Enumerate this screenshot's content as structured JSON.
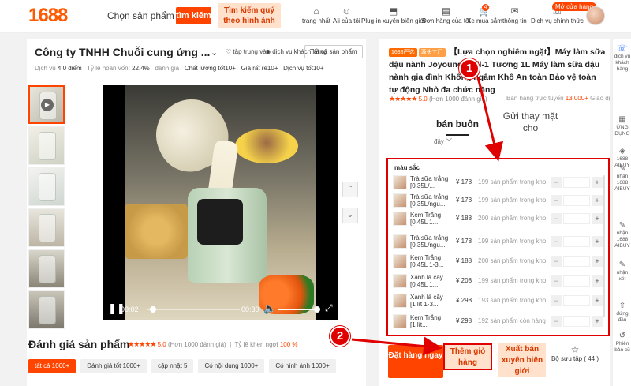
{
  "header": {
    "logo": "1688",
    "search_label": "Chọn sản phẩm tốt",
    "search_button": "tìm kiếm",
    "image_search_line1": "Tìm kiếm quý",
    "image_search_line2": "theo hình ảnh",
    "nav": [
      {
        "label": "trang nhất",
        "icon": "home-icon"
      },
      {
        "label": "Ali của tôi",
        "icon": "user-icon"
      },
      {
        "label": "Plug-in xuyên biên giới",
        "icon": "plugin-icon"
      },
      {
        "label": "Đơn hàng của tôi",
        "icon": "orders-icon"
      },
      {
        "label": "Xe mua sắm",
        "icon": "cart-icon",
        "badge": "4"
      },
      {
        "label": "thông tin",
        "icon": "message-icon"
      },
      {
        "label": "Dịch vụ chính thức",
        "icon": "headset-icon"
      }
    ],
    "store_badge": "Mở cửa hàng"
  },
  "store": {
    "company": "Công ty TNHH Chuỗi cung ứng ...",
    "follow": "tập trung vào",
    "contact": "dịch vụ khách hàng",
    "all_products": "Tất cả sản phẩm",
    "service_label": "Dịch vụ",
    "service_score": "4.0 điểm",
    "return_label": "Tỷ lệ hoàn vốn",
    "return_value": ": 22.4%",
    "eval_label": "đánh giá",
    "quality": "Chất lượng tốt10+",
    "price": "Giá rất rẻ10+",
    "service_good": "Dịch vụ tốt10+"
  },
  "video": {
    "current": "00:02",
    "duration": "00:30",
    "progress": 0.07
  },
  "reviews": {
    "title": "Đánh giá sản phẩm",
    "stars": "★★★★★",
    "score": "5.0",
    "count": "(Hơn 1000 đánh giá)",
    "recommend_label": "Tỷ lệ khen ngợi",
    "recommend_value": "100 %",
    "chips": [
      "tất cả 1000+",
      "Đánh giá tốt 1000+",
      "cập nhật 5",
      "Có nội dung 1000+",
      "Có hình ảnh 1000+"
    ]
  },
  "product": {
    "tag1": "1688严选",
    "tag2": "源头工厂",
    "title": "【Lựa chọn nghiêm ngặt】Máy làm sữa đậu nành Joyoung Wall-1 Tương 1L Máy làm sữa đậu nành gia đình Không ngâm Khô An toàn Bảo vệ toàn tự động Nhỏ đa chức năng",
    "stars": "★★★★★",
    "score": "5.0",
    "count": "(Hơn 1000 đánh giá)",
    "online_label": "Bán hàng trực tuyến",
    "online_value": "13.000+",
    "online_suffix": "Giao dị",
    "tab_wholesale": "bán buôn",
    "tab_dropship": "Gửi thay mặt cho",
    "filter": "đây ﹀",
    "variant_label": "màu sắc",
    "variants": [
      {
        "name1": "Trà sữa trắng",
        "name2": "[0.35L/...",
        "price": "¥ 178",
        "stock": "199 sản phẩm trong kho"
      },
      {
        "name1": "Trà sữa trắng",
        "name2": "[0.35L/ngu...",
        "price": "¥ 178",
        "stock": "199 sản phẩm trong kho"
      },
      {
        "name1": "Kem Trắng",
        "name2": "[0.45L 1...",
        "price": "¥ 188",
        "stock": "200 sản phẩm trong kho"
      },
      {
        "name1": "Trà sữa trắng",
        "name2": "[0.35L/ngu...",
        "price": "¥ 178",
        "stock": "199 sản phẩm trong kho"
      },
      {
        "name1": "Kem Trắng",
        "name2": "[0.45L 1-3...",
        "price": "¥ 188",
        "stock": "200 sản phẩm trong kho"
      },
      {
        "name1": "Xanh lá cây",
        "name2": "[0.45L 1...",
        "price": "¥ 208",
        "stock": "199 sản phẩm trong kho"
      },
      {
        "name1": "Xanh lá cây",
        "name2": "[1 lít 1-3...",
        "price": "¥ 298",
        "stock": "193 sản phẩm trong kho"
      },
      {
        "name1": "Kem Trắng",
        "name2": "[1 lít...",
        "price": "¥ 298",
        "stock": "192 sản phẩm còn hàng"
      }
    ],
    "order_button": "Đặt hàng ngay",
    "cart_button": "Thêm giỏ hàng",
    "dropship_button": "Xuất bán xuyên biên giới",
    "collect_label": "Bộ sưu tập ( 44 )"
  },
  "annotations": [
    "1",
    "2"
  ],
  "sidebar": [
    {
      "label": "dịch vụ khách hàng",
      "icon": "headset-icon"
    },
    {
      "label": "ỨNG DỤNG",
      "icon": "app-icon"
    },
    {
      "label": "1688 AIBUY",
      "icon": "ai-icon"
    },
    {
      "label": "nhận 1688 AIBUY",
      "icon": "edit-icon"
    },
    {
      "label": "nhận 1688 AIBUY",
      "icon": "edit-icon"
    },
    {
      "label": "nhận xét",
      "icon": "edit-icon"
    },
    {
      "label": "đứng đầu",
      "icon": "top-icon"
    },
    {
      "label": "Phiên bản cũ",
      "icon": "old-version-icon"
    }
  ],
  "colors": {
    "accent": "#ff4400",
    "annotation": "#e00000",
    "light": "#ffe1cc"
  }
}
